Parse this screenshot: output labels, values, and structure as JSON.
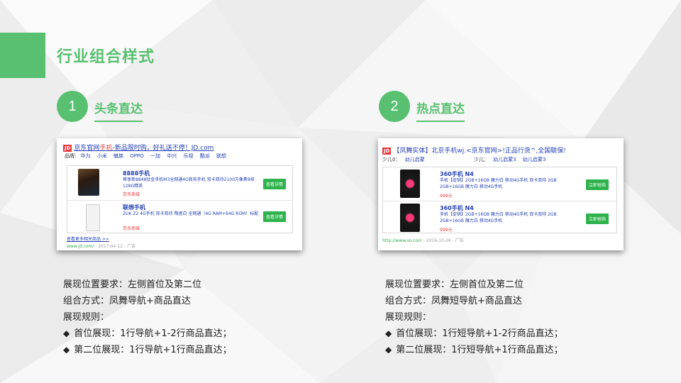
{
  "slide": {
    "title": "行业组合样式",
    "accent_color": "#58c070"
  },
  "sections": [
    {
      "number": "1",
      "title": "头条直达",
      "preview": {
        "logo": "JD",
        "ad_title_pre": "京东官网",
        "ad_title_hl": "手机",
        "ad_title_post": "-新品限时购，好礼送不停！JD.com",
        "brand_label": "品牌:",
        "brands": [
          "华为",
          "小米",
          "魅族",
          "OPPO",
          "一加",
          "中兴",
          "乐视",
          "酷派",
          "联想"
        ],
        "products": [
          {
            "name": "8888手机",
            "desc": "尊享新8848钛金手机M3全网通4G商务手机 双卡双待2100万像素8核128G精英",
            "shop": "京东商城",
            "button": "查看详情"
          },
          {
            "name": "联想手机",
            "desc": "ZUK Z2 4G手机 双卡双待 陶瓷白 全网通（4G RAM+64G ROM）标配",
            "shop": "京东商城",
            "button": "查看详情"
          }
        ],
        "more_link": "查看更多相关商品 >>",
        "url": "www.jd.com/",
        "date": "2017-04-12",
        "ad_tag": "广告"
      },
      "lines": [
        "展现位置要求：左侧首位及第二位",
        "组合方式：凤舞导航+商品直达",
        "展现规则："
      ],
      "bullets": [
        "首位展现：1行导航+1-2行商品直达；",
        "第二位展现：1行导航+1行商品直达；"
      ]
    },
    {
      "number": "2",
      "title": "热点直达",
      "preview": {
        "logo": "JD",
        "ad_title": "【凤舞实体】北京手机wj.<京东官网>!正品行货^,全国联保!",
        "nav_items": [
          "少儿0：",
          "幼儿启蒙",
          "少儿：",
          "幼儿启蒙3",
          "幼儿启蒙3"
        ],
        "products": [
          {
            "name": "360手机 N4",
            "desc": "手机【促销】2GB+16GB 魔力白 移动4G手机 双卡双待 2GB 2GB+16GB 魔力白 移动4G手机",
            "price": "999元",
            "button": "立即抢购"
          },
          {
            "name": "360手机 N4",
            "desc": "手机【促销】2GB+16GB 魔力白 移动4G手机 双卡双待 2GB 2GB+16GB 魔力白 移动4G手机",
            "price": "999元",
            "button": "立即抢购"
          }
        ],
        "url": "http://www.so.com",
        "date": "2016-10-26",
        "ad_tag": "广告"
      },
      "lines": [
        "展现位置要求：左侧首位及第二位",
        "组合方式：凤舞短导航+商品直达",
        "展现规则："
      ],
      "bullets": [
        "首位展现：1行短导航+1-2行商品直达；",
        "第二位展现：1行短导航+1行商品直达；"
      ]
    }
  ]
}
